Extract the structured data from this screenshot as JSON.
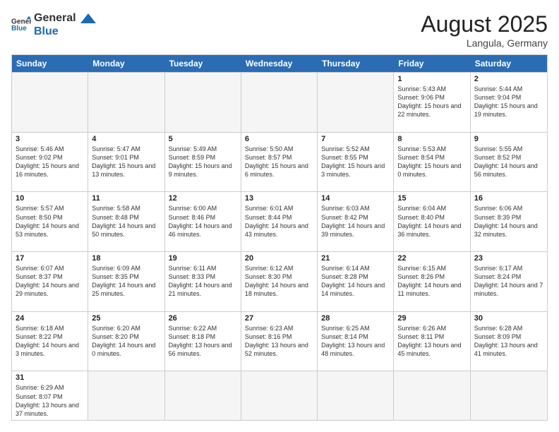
{
  "header": {
    "logo_general": "General",
    "logo_blue": "Blue",
    "month_title": "August 2025",
    "subtitle": "Langula, Germany"
  },
  "weekdays": [
    "Sunday",
    "Monday",
    "Tuesday",
    "Wednesday",
    "Thursday",
    "Friday",
    "Saturday"
  ],
  "rows": [
    [
      {
        "day": "",
        "info": ""
      },
      {
        "day": "",
        "info": ""
      },
      {
        "day": "",
        "info": ""
      },
      {
        "day": "",
        "info": ""
      },
      {
        "day": "",
        "info": ""
      },
      {
        "day": "1",
        "info": "Sunrise: 5:43 AM\nSunset: 9:06 PM\nDaylight: 15 hours and 22 minutes."
      },
      {
        "day": "2",
        "info": "Sunrise: 5:44 AM\nSunset: 9:04 PM\nDaylight: 15 hours and 19 minutes."
      }
    ],
    [
      {
        "day": "3",
        "info": "Sunrise: 5:46 AM\nSunset: 9:02 PM\nDaylight: 15 hours and 16 minutes."
      },
      {
        "day": "4",
        "info": "Sunrise: 5:47 AM\nSunset: 9:01 PM\nDaylight: 15 hours and 13 minutes."
      },
      {
        "day": "5",
        "info": "Sunrise: 5:49 AM\nSunset: 8:59 PM\nDaylight: 15 hours and 9 minutes."
      },
      {
        "day": "6",
        "info": "Sunrise: 5:50 AM\nSunset: 8:57 PM\nDaylight: 15 hours and 6 minutes."
      },
      {
        "day": "7",
        "info": "Sunrise: 5:52 AM\nSunset: 8:55 PM\nDaylight: 15 hours and 3 minutes."
      },
      {
        "day": "8",
        "info": "Sunrise: 5:53 AM\nSunset: 8:54 PM\nDaylight: 15 hours and 0 minutes."
      },
      {
        "day": "9",
        "info": "Sunrise: 5:55 AM\nSunset: 8:52 PM\nDaylight: 14 hours and 56 minutes."
      }
    ],
    [
      {
        "day": "10",
        "info": "Sunrise: 5:57 AM\nSunset: 8:50 PM\nDaylight: 14 hours and 53 minutes."
      },
      {
        "day": "11",
        "info": "Sunrise: 5:58 AM\nSunset: 8:48 PM\nDaylight: 14 hours and 50 minutes."
      },
      {
        "day": "12",
        "info": "Sunrise: 6:00 AM\nSunset: 8:46 PM\nDaylight: 14 hours and 46 minutes."
      },
      {
        "day": "13",
        "info": "Sunrise: 6:01 AM\nSunset: 8:44 PM\nDaylight: 14 hours and 43 minutes."
      },
      {
        "day": "14",
        "info": "Sunrise: 6:03 AM\nSunset: 8:42 PM\nDaylight: 14 hours and 39 minutes."
      },
      {
        "day": "15",
        "info": "Sunrise: 6:04 AM\nSunset: 8:40 PM\nDaylight: 14 hours and 36 minutes."
      },
      {
        "day": "16",
        "info": "Sunrise: 6:06 AM\nSunset: 8:39 PM\nDaylight: 14 hours and 32 minutes."
      }
    ],
    [
      {
        "day": "17",
        "info": "Sunrise: 6:07 AM\nSunset: 8:37 PM\nDaylight: 14 hours and 29 minutes."
      },
      {
        "day": "18",
        "info": "Sunrise: 6:09 AM\nSunset: 8:35 PM\nDaylight: 14 hours and 25 minutes."
      },
      {
        "day": "19",
        "info": "Sunrise: 6:11 AM\nSunset: 8:33 PM\nDaylight: 14 hours and 21 minutes."
      },
      {
        "day": "20",
        "info": "Sunrise: 6:12 AM\nSunset: 8:30 PM\nDaylight: 14 hours and 18 minutes."
      },
      {
        "day": "21",
        "info": "Sunrise: 6:14 AM\nSunset: 8:28 PM\nDaylight: 14 hours and 14 minutes."
      },
      {
        "day": "22",
        "info": "Sunrise: 6:15 AM\nSunset: 8:26 PM\nDaylight: 14 hours and 11 minutes."
      },
      {
        "day": "23",
        "info": "Sunrise: 6:17 AM\nSunset: 8:24 PM\nDaylight: 14 hours and 7 minutes."
      }
    ],
    [
      {
        "day": "24",
        "info": "Sunrise: 6:18 AM\nSunset: 8:22 PM\nDaylight: 14 hours and 3 minutes."
      },
      {
        "day": "25",
        "info": "Sunrise: 6:20 AM\nSunset: 8:20 PM\nDaylight: 14 hours and 0 minutes."
      },
      {
        "day": "26",
        "info": "Sunrise: 6:22 AM\nSunset: 8:18 PM\nDaylight: 13 hours and 56 minutes."
      },
      {
        "day": "27",
        "info": "Sunrise: 6:23 AM\nSunset: 8:16 PM\nDaylight: 13 hours and 52 minutes."
      },
      {
        "day": "28",
        "info": "Sunrise: 6:25 AM\nSunset: 8:14 PM\nDaylight: 13 hours and 48 minutes."
      },
      {
        "day": "29",
        "info": "Sunrise: 6:26 AM\nSunset: 8:11 PM\nDaylight: 13 hours and 45 minutes."
      },
      {
        "day": "30",
        "info": "Sunrise: 6:28 AM\nSunset: 8:09 PM\nDaylight: 13 hours and 41 minutes."
      }
    ],
    [
      {
        "day": "31",
        "info": "Sunrise: 6:29 AM\nSunset: 8:07 PM\nDaylight: 13 hours and 37 minutes."
      },
      {
        "day": "",
        "info": ""
      },
      {
        "day": "",
        "info": ""
      },
      {
        "day": "",
        "info": ""
      },
      {
        "day": "",
        "info": ""
      },
      {
        "day": "",
        "info": ""
      },
      {
        "day": "",
        "info": ""
      }
    ]
  ]
}
